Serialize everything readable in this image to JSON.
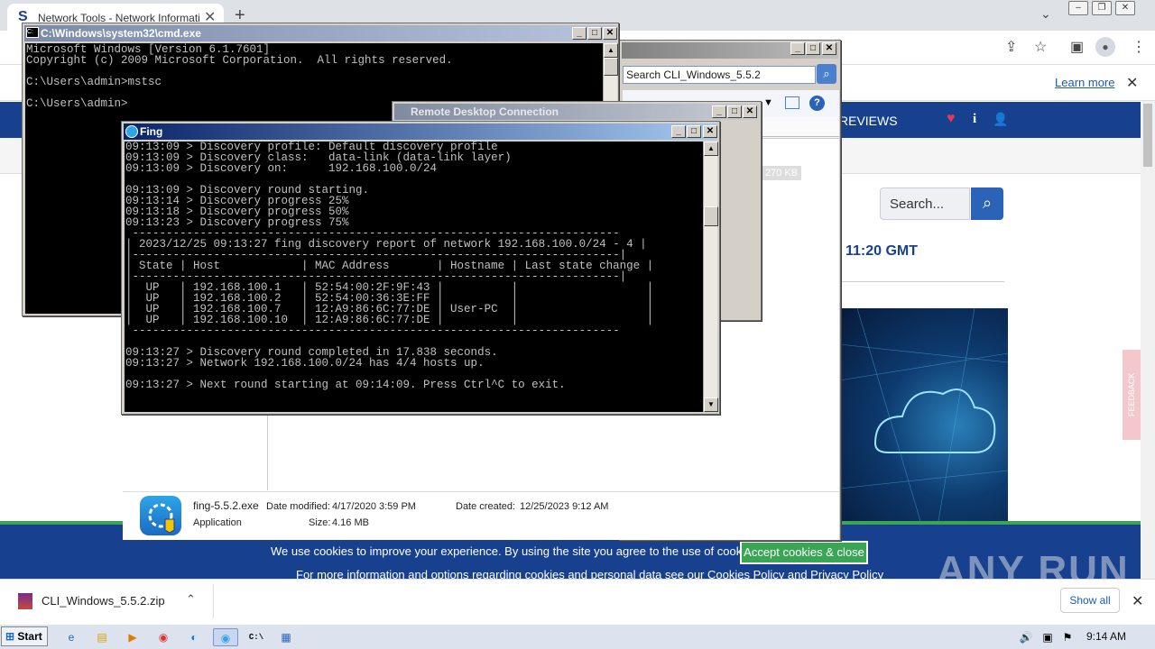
{
  "browser": {
    "tab_title": "Network Tools - Network Information",
    "learn_more": "Learn more",
    "show_all": "Show all",
    "download_name": "CLI_Windows_5.5.2.zip"
  },
  "website": {
    "nav_reviews": "REVIEWS",
    "search_placeholder": "Search...",
    "time_text": "11:20 GMT",
    "feedback": "FEEDBACK",
    "cookie_text": "We use cookies to improve your experience. By using the site you agree to the use of cookies.",
    "cookie_button": "Accept cookies & close",
    "cookie_more": "For more information and options regarding cookies and personal data see our Cookies Policy and Privacy Policy",
    "watermark": "ANY RUN"
  },
  "cmd": {
    "title": "C:\\Windows\\system32\\cmd.exe",
    "text": "Microsoft Windows [Version 6.1.7601]\nCopyright (c) 2009 Microsoft Corporation.  All rights reserved.\n\nC:\\Users\\admin>mstsc\n\nC:\\Users\\admin>"
  },
  "explorer": {
    "search_text": "Search CLI_Windows_5.5.2",
    "size_badge": "270 KB",
    "help_button": "lp",
    "file_name": "fing-5.5.2.exe",
    "file_type": "Application",
    "date_modified_label": "Date modified:",
    "date_modified": "4/17/2020 3:59 PM",
    "size_label": "Size:",
    "size": "4.16 MB",
    "date_created_label": "Date created:",
    "date_created": "12/25/2023 9:12 AM"
  },
  "rdc": {
    "title": "Remote Desktop Connection"
  },
  "fing": {
    "title": "Fing",
    "text": "09:13:09 > Discovery profile: Default discovery profile\n09:13:09 > Discovery class:   data-link (data-link layer)\n09:13:09 > Discovery on:      192.168.100.0/24\n\n09:13:09 > Discovery round starting.\n09:13:14 > Discovery progress 25%\n09:13:18 > Discovery progress 50%\n09:13:23 > Discovery progress 75%\n ------------------------------------------------------------------------\n| 2023/12/25 09:13:27 fing discovery report of network 192.168.100.0/24 - 4 |\n|------------------------------------------------------------------------|\n| State | Host            | MAC Address       | Hostname | Last state change |\n|------------------------------------------------------------------------|\n|  UP   | 192.168.100.1   | 52:54:00:2F:9F:43 |          |                   |\n|  UP   | 192.168.100.2   | 52:54:00:36:3E:FF |          |                   |\n|  UP   | 192.168.100.7   | 12:A9:86:6C:77:DE | User-PC  |                   |\n|  UP   | 192.168.100.10  | 12:A9:86:6C:77:DE |          |                   |\n ------------------------------------------------------------------------\n\n09:13:27 > Discovery round completed in 17.838 seconds.\n09:13:27 > Network 192.168.100.0/24 has 4/4 hosts up.\n\n09:13:27 > Next round starting at 09:14:09. Press Ctrl^C to exit."
  },
  "taskbar": {
    "start": "Start",
    "clock": "9:14 AM"
  }
}
